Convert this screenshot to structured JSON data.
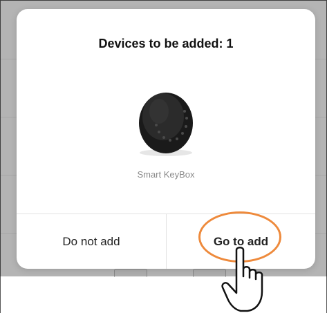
{
  "dialog": {
    "title": "Devices to be added: 1",
    "device": {
      "name": "Smart KeyBox",
      "icon": "keybox-device-icon"
    },
    "buttons": {
      "cancel_label": "Do not add",
      "confirm_label": "Go to add"
    }
  },
  "annotation": {
    "highlight_color": "#ee8a3c",
    "pointer_icon": "pointing-hand-icon"
  },
  "colors": {
    "title": "#111111",
    "device_name": "#8a8a8a",
    "button_text": "#222222"
  }
}
